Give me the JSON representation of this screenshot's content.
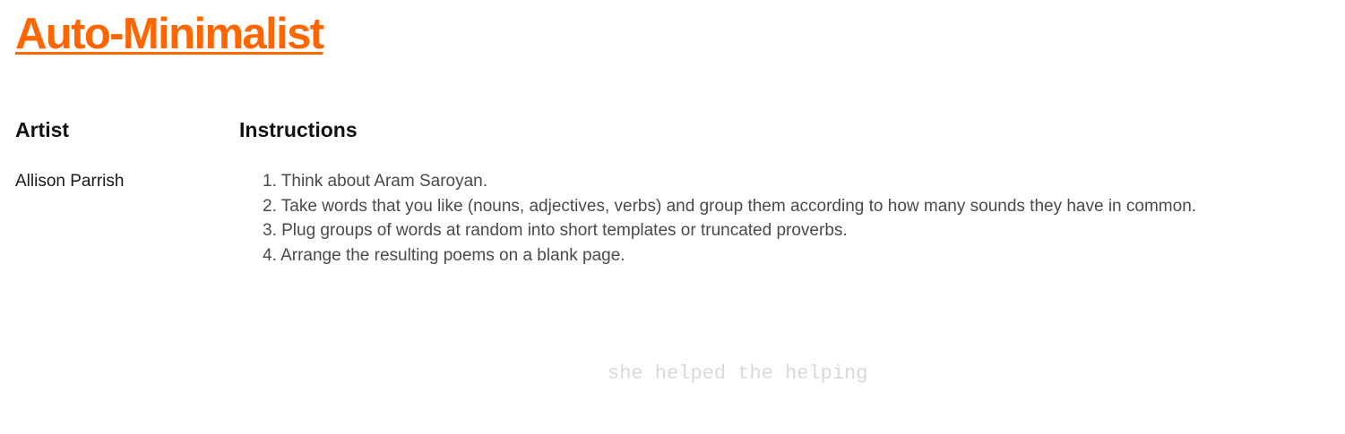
{
  "title": "Auto-Minimalist",
  "columns": {
    "artist_heading": "Artist",
    "instructions_heading": "Instructions"
  },
  "artist": "Allison Parrish",
  "instructions": [
    "1. Think about Aram Saroyan.",
    "2. Take words that you like (nouns, adjectives, verbs) and group them according to how many sounds they have in common.",
    "3. Plug groups of words at random into short templates or truncated proverbs.",
    "4. Arrange the resulting poems on a blank page."
  ],
  "poem": "she helped the helping",
  "colors": {
    "accent": "#ff6600",
    "heading": "#111111",
    "body_text": "#4a4a4a",
    "poem_text": "#d9d9d9",
    "background": "#ffffff"
  }
}
